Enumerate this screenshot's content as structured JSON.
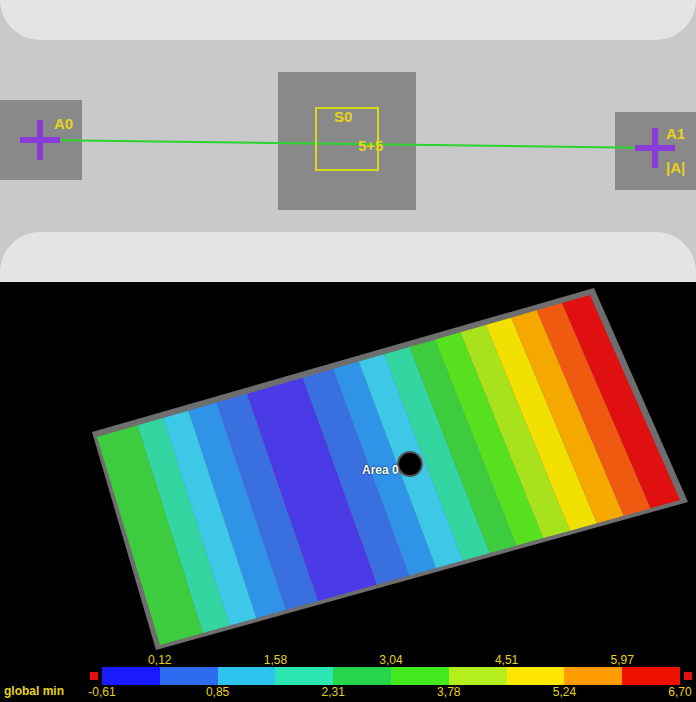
{
  "photo": {
    "markers": [
      {
        "label": "A0"
      },
      {
        "label": "A1"
      }
    ],
    "side_label": "|A|",
    "facet": {
      "label": "S0",
      "reading": "5+5"
    }
  },
  "map": {
    "label": "Area 0",
    "bands": [
      {
        "color": "#3dcc3d"
      },
      {
        "color": "#33d6a0"
      },
      {
        "color": "#3cc8e6"
      },
      {
        "color": "#2f93e8"
      },
      {
        "color": "#3a6fe0"
      },
      {
        "color": "#4a3ae6"
      },
      {
        "color": "#3a6fe0"
      },
      {
        "color": "#2f93e8"
      },
      {
        "color": "#3cc8e6"
      },
      {
        "color": "#33d6a0"
      },
      {
        "color": "#3dcc3d"
      },
      {
        "color": "#57e020"
      },
      {
        "color": "#a8e21c"
      },
      {
        "color": "#f2e000"
      },
      {
        "color": "#f5a800"
      },
      {
        "color": "#ef5a10"
      },
      {
        "color": "#e01010"
      }
    ]
  },
  "colorbar": {
    "label": "global min",
    "ticks_top": [
      "0,12",
      "1,58",
      "3,04",
      "4,51",
      "5,97"
    ],
    "ticks_bottom": [
      "-0,61",
      "0,85",
      "2,31",
      "3,78",
      "5,24",
      "6,70"
    ],
    "segments": [
      {
        "color": "#1a1aff"
      },
      {
        "color": "#2d6cf0"
      },
      {
        "color": "#2fc4f0"
      },
      {
        "color": "#2ee6b4"
      },
      {
        "color": "#26d64a"
      },
      {
        "color": "#44e81e"
      },
      {
        "color": "#b4ee1c"
      },
      {
        "color": "#ffe600"
      },
      {
        "color": "#ff9c00"
      },
      {
        "color": "#f01000"
      }
    ]
  }
}
